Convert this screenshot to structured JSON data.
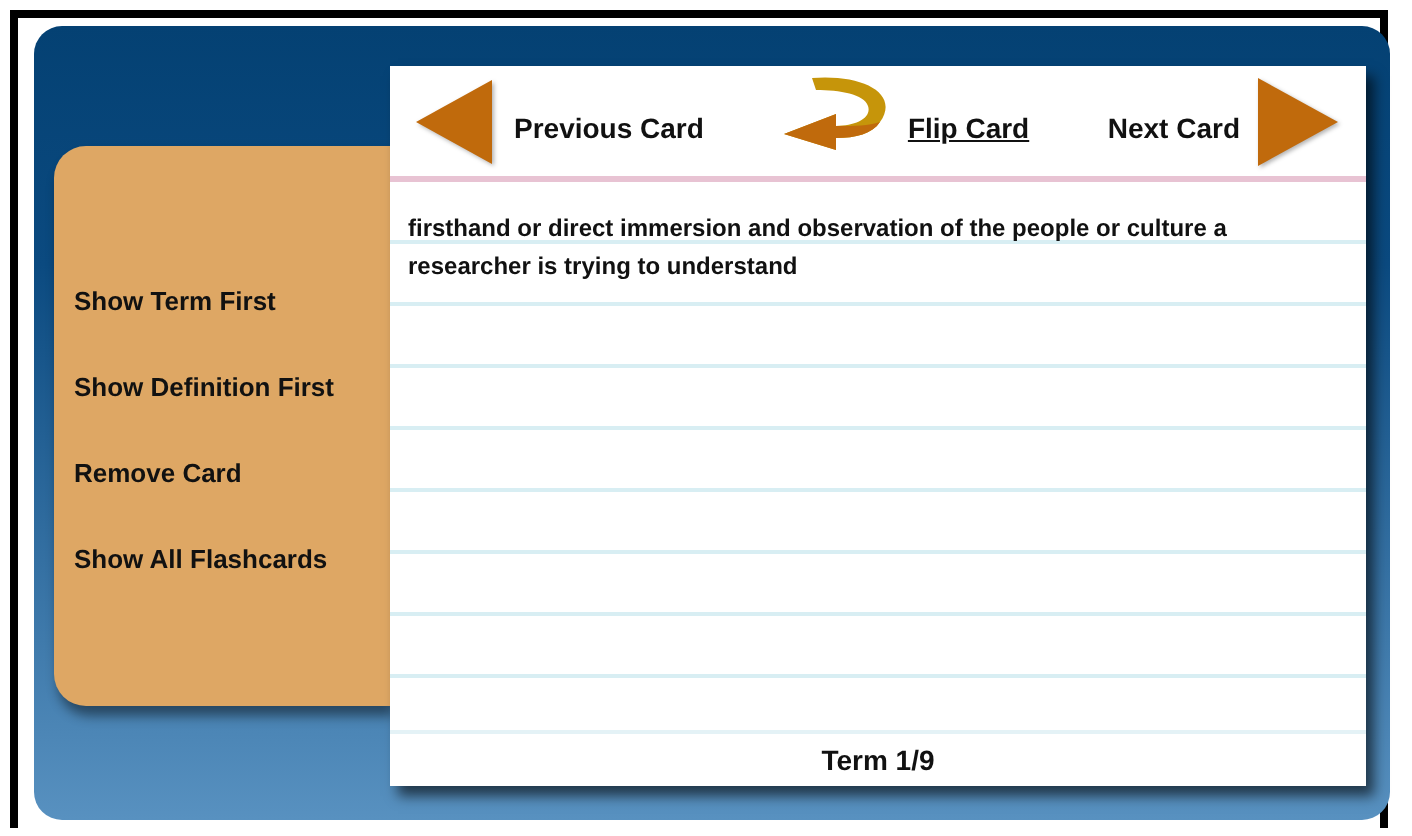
{
  "sidebar": {
    "items": [
      {
        "label": "Show Term First"
      },
      {
        "label": "Show Definition First"
      },
      {
        "label": "Remove Card"
      },
      {
        "label": "Show All Flashcards"
      }
    ]
  },
  "card": {
    "nav": [
      {
        "kind": "previous",
        "label": "Previous Card"
      },
      {
        "kind": "flip",
        "label": "Flip Card"
      },
      {
        "kind": "next",
        "label": "Next Card"
      }
    ],
    "definition": "firsthand or direct immersion and observation of the people or culture a researcher is trying to understand",
    "counter": "Term 1/9"
  }
}
